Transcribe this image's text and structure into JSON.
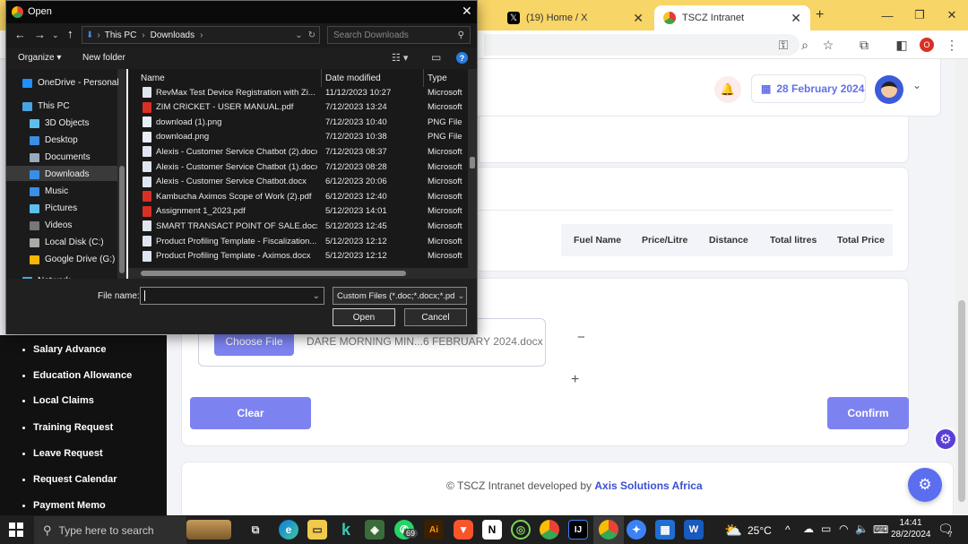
{
  "browser": {
    "tabs": [
      {
        "title": "(19) Home / X"
      },
      {
        "title": "TSCZ Intranet"
      }
    ],
    "new_tab_symbol": "+",
    "profile_initial": "O"
  },
  "header": {
    "date": "28 February 2024"
  },
  "table": {
    "columns": [
      "Fuel Name",
      "Price/Litre",
      "Distance",
      "Total litres",
      "Total Price"
    ]
  },
  "upload": {
    "choose_label": "Choose File",
    "file_name": "DARE MORNING MIN...6 FEBRUARY 2024.docx",
    "minus": "−",
    "plus": "+"
  },
  "actions": {
    "clear": "Clear",
    "confirm": "Confirm"
  },
  "footer": {
    "text": "© TSCZ Intranet developed by ",
    "link": "Axis Solutions Africa"
  },
  "sidebar": {
    "items": [
      {
        "label": "Salary Advance"
      },
      {
        "label": "Education Allowance"
      },
      {
        "label": "Local Claims"
      },
      {
        "label": "Training Request"
      },
      {
        "label": "Leave Request"
      },
      {
        "label": "Request Calendar"
      },
      {
        "label": "Payment Memo"
      }
    ]
  },
  "dialog": {
    "title": "Open",
    "breadcrumb": [
      "This PC",
      "Downloads"
    ],
    "search_placeholder": "Search Downloads",
    "organize": "Organize",
    "new_folder": "New folder",
    "columns": {
      "name": "Name",
      "date": "Date modified",
      "type": "Type"
    },
    "nav": [
      {
        "label": "OneDrive - Personal",
        "icon": "cloud-icon",
        "color": "#1e90ff"
      },
      {
        "label": "This PC",
        "icon": "computer-icon",
        "color": "#4aa3df"
      },
      {
        "label": "3D Objects",
        "icon": "cube-icon",
        "color": "#5bc0eb"
      },
      {
        "label": "Desktop",
        "icon": "desktop-icon",
        "color": "#3a8ee6"
      },
      {
        "label": "Documents",
        "icon": "document-icon",
        "color": "#9ab"
      },
      {
        "label": "Downloads",
        "icon": "download-icon",
        "color": "#3a8ee6"
      },
      {
        "label": "Music",
        "icon": "music-icon",
        "color": "#3a8ee6"
      },
      {
        "label": "Pictures",
        "icon": "picture-icon",
        "color": "#5bc0eb"
      },
      {
        "label": "Videos",
        "icon": "video-icon",
        "color": "#777"
      },
      {
        "label": "Local Disk (C:)",
        "icon": "disk-icon",
        "color": "#aaa"
      },
      {
        "label": "Google Drive (G:)",
        "icon": "gdrive-icon",
        "color": "#f4b400"
      },
      {
        "label": "Network",
        "icon": "network-icon",
        "color": "#4aa3df"
      }
    ],
    "files": [
      {
        "name": "RevMax Test Device Registration with Zi...",
        "date": "11/12/2023 10:27",
        "type": "Microsoft",
        "kind": "doc"
      },
      {
        "name": "ZIM CRICKET - USER MANUAL.pdf",
        "date": "7/12/2023 13:24",
        "type": "Microsoft",
        "kind": "pdf"
      },
      {
        "name": "download (1).png",
        "date": "7/12/2023 10:40",
        "type": "PNG File",
        "kind": "png"
      },
      {
        "name": "download.png",
        "date": "7/12/2023 10:38",
        "type": "PNG File",
        "kind": "png"
      },
      {
        "name": "Alexis - Customer Service Chatbot (2).docx",
        "date": "7/12/2023 08:37",
        "type": "Microsoft",
        "kind": "doc"
      },
      {
        "name": "Alexis - Customer Service Chatbot (1).docx",
        "date": "7/12/2023 08:28",
        "type": "Microsoft",
        "kind": "doc"
      },
      {
        "name": "Alexis - Customer Service Chatbot.docx",
        "date": "6/12/2023 20:06",
        "type": "Microsoft",
        "kind": "doc"
      },
      {
        "name": "Kambucha Aximos Scope of Work (2).pdf",
        "date": "6/12/2023 12:40",
        "type": "Microsoft",
        "kind": "pdf"
      },
      {
        "name": "Assignment 1_2023.pdf",
        "date": "5/12/2023 14:01",
        "type": "Microsoft",
        "kind": "pdf"
      },
      {
        "name": "SMART TRANSACT POINT OF SALE.docx",
        "date": "5/12/2023 12:45",
        "type": "Microsoft",
        "kind": "doc"
      },
      {
        "name": "Product Profiling Template - Fiscalization...",
        "date": "5/12/2023 12:12",
        "type": "Microsoft",
        "kind": "doc"
      },
      {
        "name": "Product Profiling Template - Aximos.docx",
        "date": "5/12/2023 12:12",
        "type": "Microsoft",
        "kind": "doc"
      }
    ],
    "file_name_label": "File name:",
    "file_name_value": "",
    "filter": "Custom Files (*.doc;*.docx;*.pd",
    "open": "Open",
    "cancel": "Cancel"
  },
  "taskbar": {
    "search_placeholder": "Type here to search",
    "whatsapp_badge": "69",
    "weather": "25°C",
    "time": "14:41",
    "date": "28/2/2024",
    "notification_count": "7"
  }
}
